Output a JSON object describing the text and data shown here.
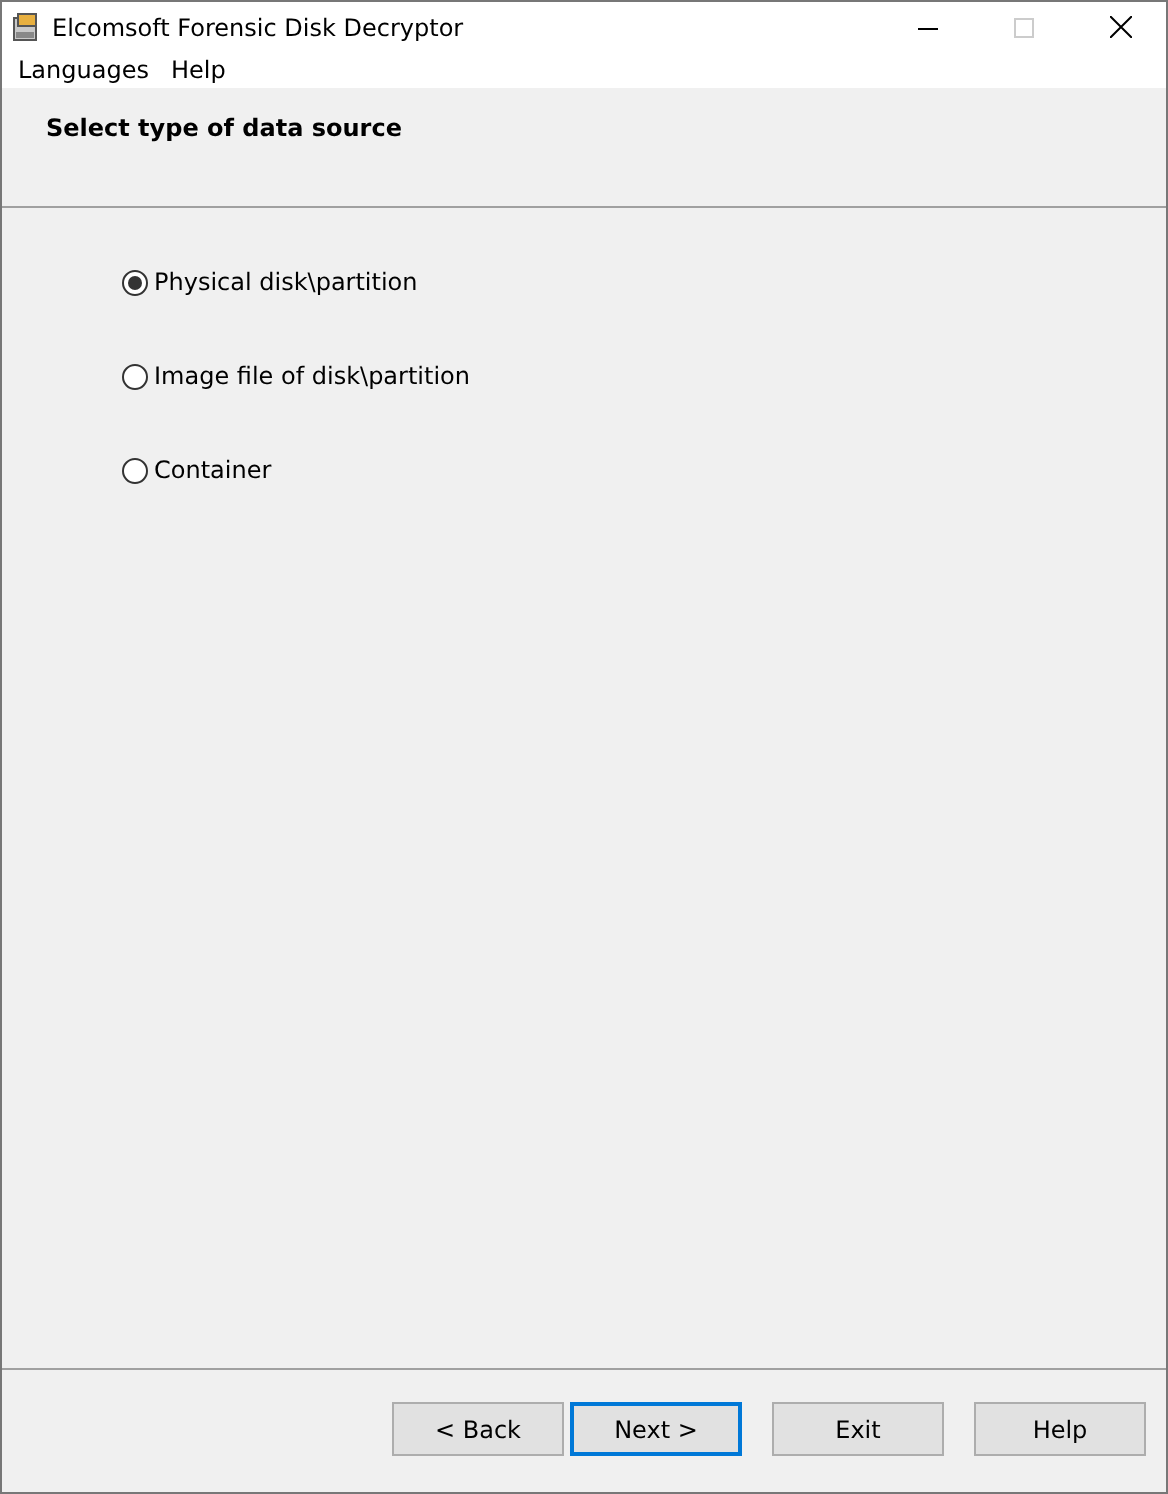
{
  "window": {
    "title": "Elcomsoft Forensic Disk Decryptor"
  },
  "menu": [
    "Languages",
    "Help"
  ],
  "header": {
    "title": "Select type of data source"
  },
  "options": [
    {
      "label": "Physical disk\\partition",
      "selected": true
    },
    {
      "label": "Image file of disk\\partition",
      "selected": false
    },
    {
      "label": "Container",
      "selected": false
    }
  ],
  "buttons": [
    {
      "label": "< Back",
      "focused": false
    },
    {
      "label": "Next >",
      "focused": true
    },
    {
      "label": "Exit",
      "focused": false
    },
    {
      "label": "Help",
      "focused": false
    }
  ]
}
